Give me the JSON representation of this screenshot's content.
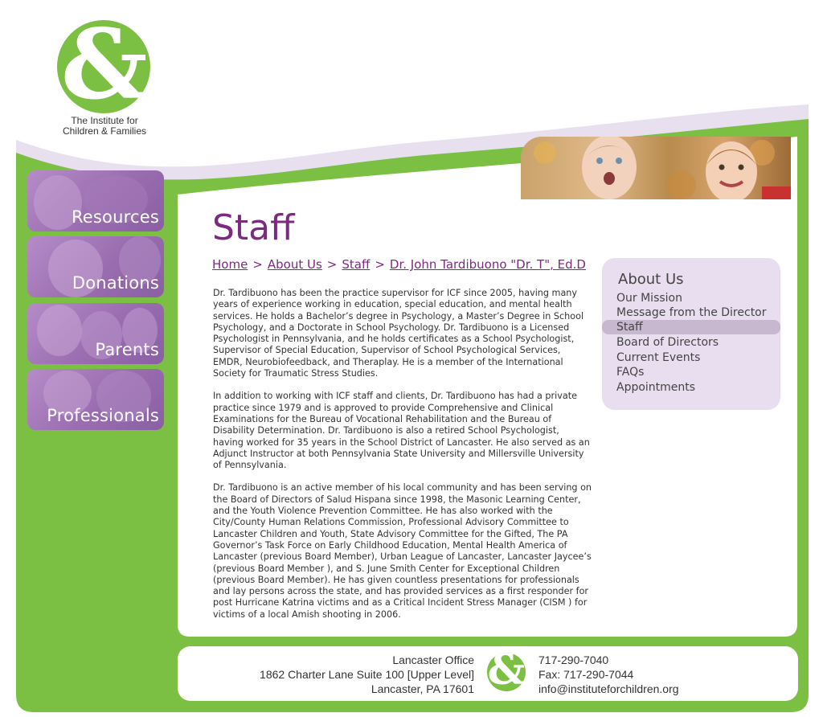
{
  "brand": {
    "logo_symbol": "&",
    "name_line1": "The Institute for",
    "name_line2": "Children & Families",
    "green": "#7cc043",
    "purple": "#7b2a80",
    "lavender": "#e8def0"
  },
  "nav": {
    "items": [
      {
        "label": "Resources"
      },
      {
        "label": "Donations"
      },
      {
        "label": "Parents"
      },
      {
        "label": "Professionals"
      }
    ]
  },
  "page": {
    "title": "Staff"
  },
  "breadcrumb": {
    "items": [
      "Home",
      "About Us",
      "Staff",
      "Dr. John Tardibuono \"Dr. T\", Ed.D"
    ],
    "separator": ">"
  },
  "content": {
    "paragraphs": [
      "Dr. Tardibuono has been the practice supervisor for ICF since 2005, having many years of experience working in education, special education, and mental health services. He holds a Bachelor’s degree in Psychology, a Master’s Degree in School Psychology, and a Doctorate in School Psychology. Dr. Tardibuono is a Licensed Psychologist in Pennsylvania, and he holds certificates as a School Psychologist, Supervisor of Special Education, Supervisor of School Psychological Services, EMDR, Neurobiofeedback, and Theraplay. He is a member of the International Society for Traumatic Stress Studies.",
      "In addition to working with ICF staff and clients, Dr. Tardibuono has had a private practice since 1979 and is approved to provide Comprehensive and Clinical Examinations for the Bureau of Vocational Rehabilitation and the Bureau of Disability Determination. Dr. Tardibuono is also a retired School Psychologist, having worked for 35 years in the School District of Lancaster. He also served as an Adjunct Instructor at both Pennsylvania State University and Millersville University of Pennsylvania.",
      "Dr. Tardibuono is an active member of his local community and has been serving on the Board of Directors of Salud Hispana since 1998, the Masonic Learning Center, and the Youth Violence Prevention Committee. He has also worked with the City/County Human Relations Commission, Professional Advisory Committee to Lancaster Children and Youth, State Advisory Committee for the Gifted, The PA Governor’s Task Force on Early Childhood Education, Mental Health America of Lancaster (previous Board Member), Urban League of Lancaster, Lancaster Jaycee’s (previous Board Member ), and S. June Smith Center for Exceptional Children (previous Board Member). He has given countless presentations for professionals and lay persons across the state, and has provided services as a first responder for post Hurricane Katrina victims and as a Critical Incident Stress Manager (CISM ) for victims of a local Amish shooting in 2006."
    ]
  },
  "sidebar": {
    "title": "About Us",
    "items": [
      {
        "label": "Our Mission"
      },
      {
        "label": "Message from the Director"
      },
      {
        "label": "Staff"
      },
      {
        "label": "Board of Directors"
      },
      {
        "label": "Current Events"
      },
      {
        "label": "FAQs"
      },
      {
        "label": "Appointments"
      }
    ],
    "active_index": 2
  },
  "footer": {
    "office_line1": "Lancaster Office",
    "office_line2": "1862 Charter Lane Suite 100 [Upper Level]",
    "office_line3": "Lancaster, PA 17601",
    "phone": "717-290-7040",
    "fax": "Fax: 717-290-7044",
    "email": "info@instituteforchildren.org"
  }
}
